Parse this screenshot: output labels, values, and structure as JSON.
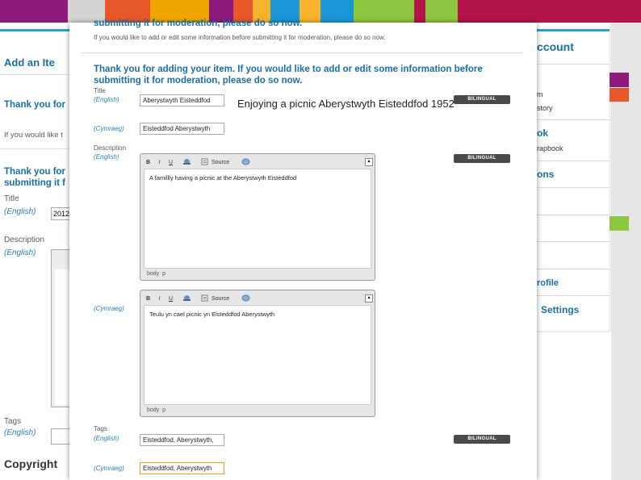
{
  "banner_colors": [
    "#8c1a7b",
    "#d4d4d4",
    "#e8572a",
    "#f0a500",
    "#8c1a7b",
    "#e8572a",
    "#f7b32b",
    "#1a95d6",
    "#f7b32b",
    "#1a95d6",
    "#8dc63f",
    "#b5134b",
    "#8dc63f",
    "#b5134b"
  ],
  "background": {
    "add_item_heading": "Add an Ite",
    "thanks_line1": "Thank you for",
    "thanks_line2": "If you would like t",
    "thanks2_line1": "Thank you for",
    "thanks2_line2": "submitting it f",
    "title_label": "Title",
    "title_lang": "(English)",
    "title_value": "2012",
    "description_label": "Description",
    "description_lang": "(English)",
    "tags_label": "Tags",
    "tags_lang": "(English)",
    "copyright_label": "Copyright",
    "right_menu": {
      "account": "ccount",
      "item1a": "m",
      "item1b": "story",
      "item2a": "ok",
      "item2b": "rapbook",
      "item3": "ons",
      "profile": "rofile",
      "settings": "Settings"
    }
  },
  "modal": {
    "top_partial_title": "submitting it for moderation, please do so now.",
    "top_partial_hint": "If you would like to add or edit some information before submitting it for moderation, please do so now.",
    "heading_line1": "Thank you for adding your item. If you would like to add or edit some information before",
    "heading_line2": "submitting it for moderation, please do so now.",
    "title_label": "Title",
    "lang_english": "(English)",
    "lang_welsh": "(Cymraeg)",
    "title_en_value": "Aberystwyth Eisteddfod",
    "title_cy_value": "Eisteddfod Aberystwyth",
    "description_label": "Description",
    "description_en": "A famillly having a picnic at the Aberystwyth Eisteddfod",
    "description_cy": "Teulu yn cael picnic yn Eisteddfod Aberystwyth",
    "toolbar": {
      "bold": "B",
      "italic": "I",
      "underline": "U",
      "source": "Source"
    },
    "editor_footer": {
      "body": "body",
      "p": "p"
    },
    "tags_label": "Tags",
    "tags_en_value": "Eisteddfod, Aberystwyth,",
    "tags_cy_value": "Eisteddfod, Aberystwyth",
    "bilingual_label": "BILINGUAL"
  },
  "overlay_caption": "Enjoying a picnic Aberystwyth Eisteddfod 1952"
}
